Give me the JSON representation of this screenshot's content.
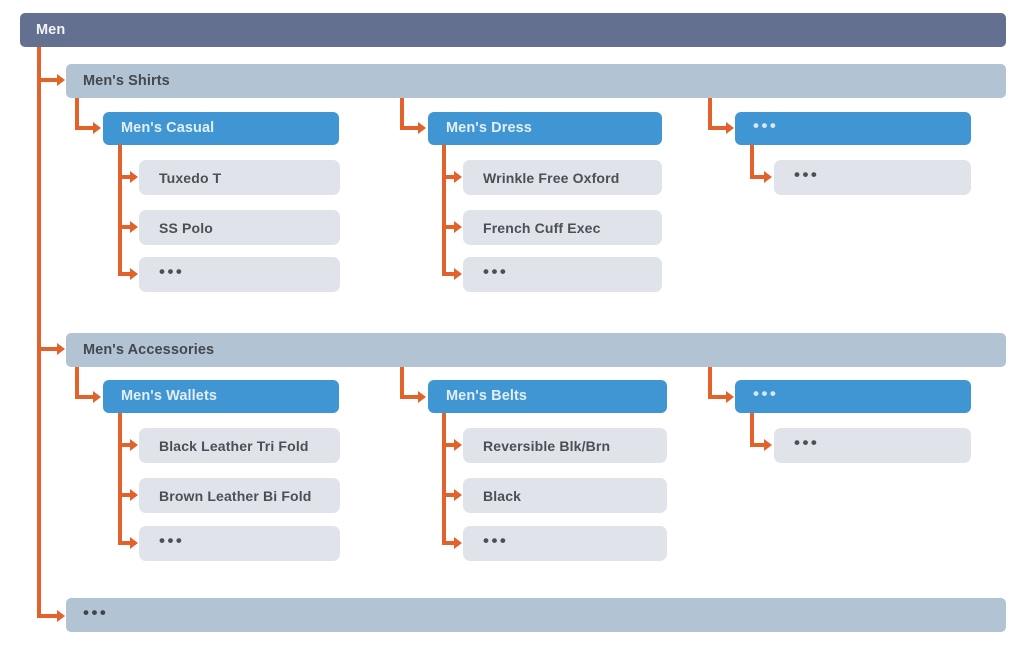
{
  "diagram": {
    "title": "Men",
    "accent_color": "#e2622c",
    "root_color": "#63708f",
    "level1_color": "#b2c4d4",
    "level2_color": "#3f96d2",
    "leaf_color": "#e0e4ea",
    "ellipsis": "•••",
    "root": {
      "label": "Men"
    },
    "branches": [
      {
        "label": "Men's Shirts",
        "groups": [
          {
            "label": "Men's Casual",
            "items": [
              {
                "label": "Tuxedo T"
              },
              {
                "label": "SS Polo"
              },
              {
                "label": "•••"
              }
            ]
          },
          {
            "label": "Men's Dress",
            "items": [
              {
                "label": "Wrinkle Free Oxford"
              },
              {
                "label": "French Cuff Exec"
              },
              {
                "label": "•••"
              }
            ]
          },
          {
            "label": "•••",
            "items": [
              {
                "label": "•••"
              }
            ]
          }
        ]
      },
      {
        "label": "Men's Accessories",
        "groups": [
          {
            "label": "Men's Wallets",
            "items": [
              {
                "label": "Black Leather Tri Fold"
              },
              {
                "label": "Brown Leather Bi Fold"
              },
              {
                "label": "•••"
              }
            ]
          },
          {
            "label": "Men's Belts",
            "items": [
              {
                "label": "Reversible Blk/Brn"
              },
              {
                "label": "Black"
              },
              {
                "label": "•••"
              }
            ]
          },
          {
            "label": "•••",
            "items": [
              {
                "label": "•••"
              }
            ]
          }
        ]
      },
      {
        "label": "•••",
        "groups": []
      }
    ]
  }
}
